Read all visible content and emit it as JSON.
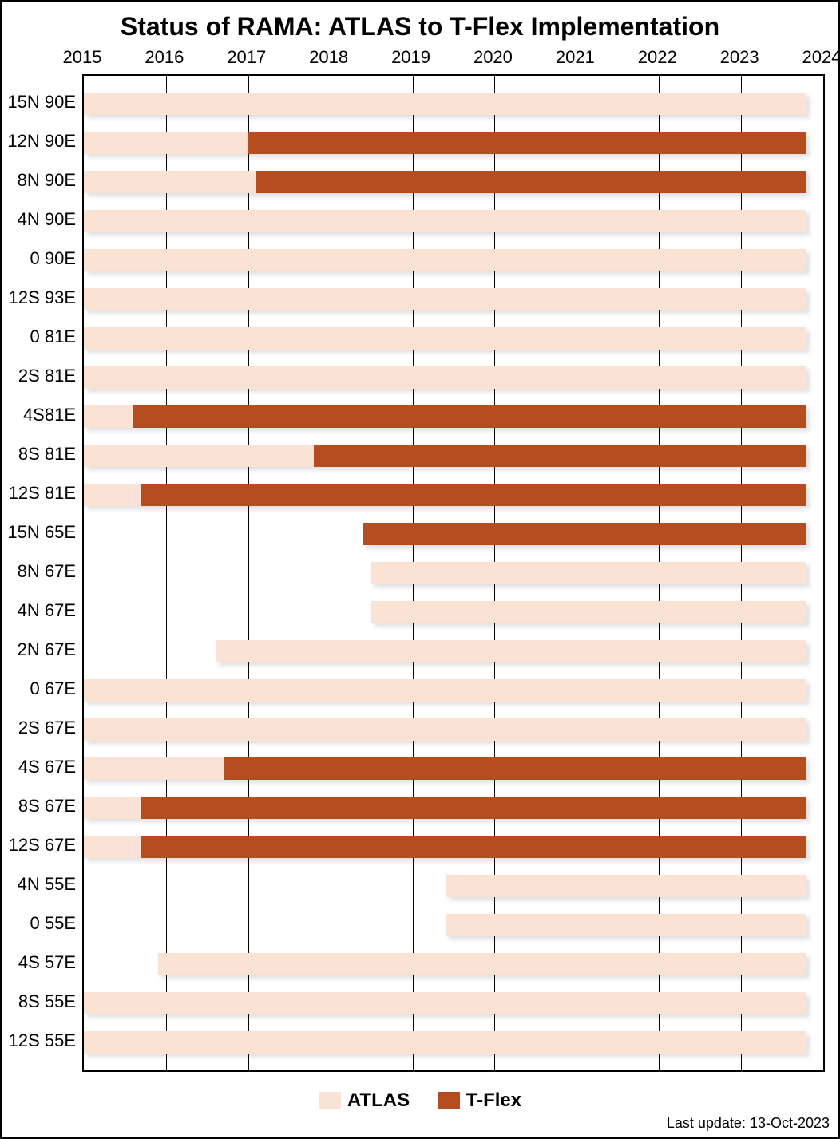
{
  "chart_data": {
    "type": "bar",
    "title": "Status of RAMA: ATLAS to T-Flex Implementation",
    "x_ticks": [
      2015,
      2016,
      2017,
      2018,
      2019,
      2020,
      2021,
      2022,
      2023,
      2024
    ],
    "xlim": [
      2015,
      2024
    ],
    "categories": [
      "15N 90E",
      "12N 90E",
      "8N 90E",
      "4N 90E",
      "0 90E",
      "12S 93E",
      "0 81E",
      "2S 81E",
      "4S81E",
      "8S 81E",
      "12S 81E",
      "15N 65E",
      "8N 67E",
      "4N 67E",
      "2N 67E",
      "0 67E",
      "2S 67E",
      "4S 67E",
      "8S 67E",
      "12S 67E",
      "4N 55E",
      "0 55E",
      "4S 57E",
      "8S 55E",
      "12S 55E"
    ],
    "series": [
      {
        "name": "ATLAS",
        "color": "#FAE3D4",
        "segments": [
          {
            "category": "15N 90E",
            "start": 2015.0,
            "end": 2023.8
          },
          {
            "category": "12N 90E",
            "start": 2015.0,
            "end": 2017.0
          },
          {
            "category": "8N 90E",
            "start": 2015.0,
            "end": 2017.1
          },
          {
            "category": "4N 90E",
            "start": 2015.0,
            "end": 2023.8
          },
          {
            "category": "0 90E",
            "start": 2015.0,
            "end": 2023.8
          },
          {
            "category": "12S 93E",
            "start": 2015.0,
            "end": 2023.8
          },
          {
            "category": "0 81E",
            "start": 2015.0,
            "end": 2023.8
          },
          {
            "category": "2S 81E",
            "start": 2015.0,
            "end": 2023.8
          },
          {
            "category": "4S81E",
            "start": 2015.0,
            "end": 2015.6
          },
          {
            "category": "8S 81E",
            "start": 2015.0,
            "end": 2017.8
          },
          {
            "category": "12S 81E",
            "start": 2015.0,
            "end": 2015.7
          },
          {
            "category": "8N 67E",
            "start": 2018.5,
            "end": 2023.8
          },
          {
            "category": "4N 67E",
            "start": 2018.5,
            "end": 2023.8
          },
          {
            "category": "2N 67E",
            "start": 2016.6,
            "end": 2023.8
          },
          {
            "category": "0 67E",
            "start": 2015.0,
            "end": 2023.8
          },
          {
            "category": "2S 67E",
            "start": 2015.0,
            "end": 2023.8
          },
          {
            "category": "4S 67E",
            "start": 2015.0,
            "end": 2016.7
          },
          {
            "category": "8S 67E",
            "start": 2015.0,
            "end": 2015.7
          },
          {
            "category": "12S 67E",
            "start": 2015.0,
            "end": 2015.7
          },
          {
            "category": "4N 55E",
            "start": 2019.4,
            "end": 2023.8
          },
          {
            "category": "0 55E",
            "start": 2019.4,
            "end": 2023.8
          },
          {
            "category": "4S 57E",
            "start": 2015.9,
            "end": 2023.8
          },
          {
            "category": "8S 55E",
            "start": 2015.0,
            "end": 2023.8
          },
          {
            "category": "12S 55E",
            "start": 2015.0,
            "end": 2023.8
          }
        ]
      },
      {
        "name": "T-Flex",
        "color": "#B64D20",
        "segments": [
          {
            "category": "12N 90E",
            "start": 2017.0,
            "end": 2023.8
          },
          {
            "category": "8N 90E",
            "start": 2017.1,
            "end": 2023.8
          },
          {
            "category": "4S81E",
            "start": 2015.6,
            "end": 2023.8
          },
          {
            "category": "8S 81E",
            "start": 2017.8,
            "end": 2023.8
          },
          {
            "category": "12S 81E",
            "start": 2015.7,
            "end": 2023.8
          },
          {
            "category": "15N 65E",
            "start": 2018.4,
            "end": 2023.8
          },
          {
            "category": "4S 67E",
            "start": 2016.7,
            "end": 2023.8
          },
          {
            "category": "8S 67E",
            "start": 2015.7,
            "end": 2023.8
          },
          {
            "category": "12S 67E",
            "start": 2015.7,
            "end": 2023.8
          }
        ]
      }
    ],
    "legend_labels": {
      "atlas": "ATLAS",
      "tflex": "T-Flex"
    },
    "footer": "Last update: 13-Oct-2023"
  }
}
